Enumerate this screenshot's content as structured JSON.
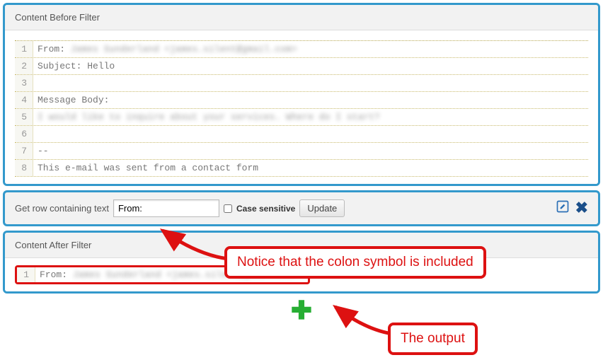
{
  "before": {
    "header": "Content Before Filter",
    "lines": [
      {
        "n": "1",
        "prefix": "From: ",
        "blur": "James Sunderland <james.silent@gmail.com>"
      },
      {
        "n": "2",
        "text": "Subject: Hello"
      },
      {
        "n": "3",
        "text": ""
      },
      {
        "n": "4",
        "text": "Message Body:"
      },
      {
        "n": "5",
        "blur": "I would like to inquire about your services. Where do I start?"
      },
      {
        "n": "6",
        "text": ""
      },
      {
        "n": "7",
        "text": "--"
      },
      {
        "n": "8",
        "text": "This e-mail was sent from a contact form"
      }
    ]
  },
  "filter": {
    "label": "Get row containing text",
    "value": "From:",
    "case_label": "Case sensitive",
    "update_label": "Update",
    "close_glyph": "✖"
  },
  "after": {
    "header": "Content After Filter",
    "line": {
      "n": "1",
      "prefix": "From: ",
      "blur": "James Sunderland <james.silent@gmail.com>"
    }
  },
  "plus": {
    "glyph": "✚"
  },
  "callouts": {
    "c1": "Notice that the colon symbol is included",
    "c2": "The output"
  }
}
